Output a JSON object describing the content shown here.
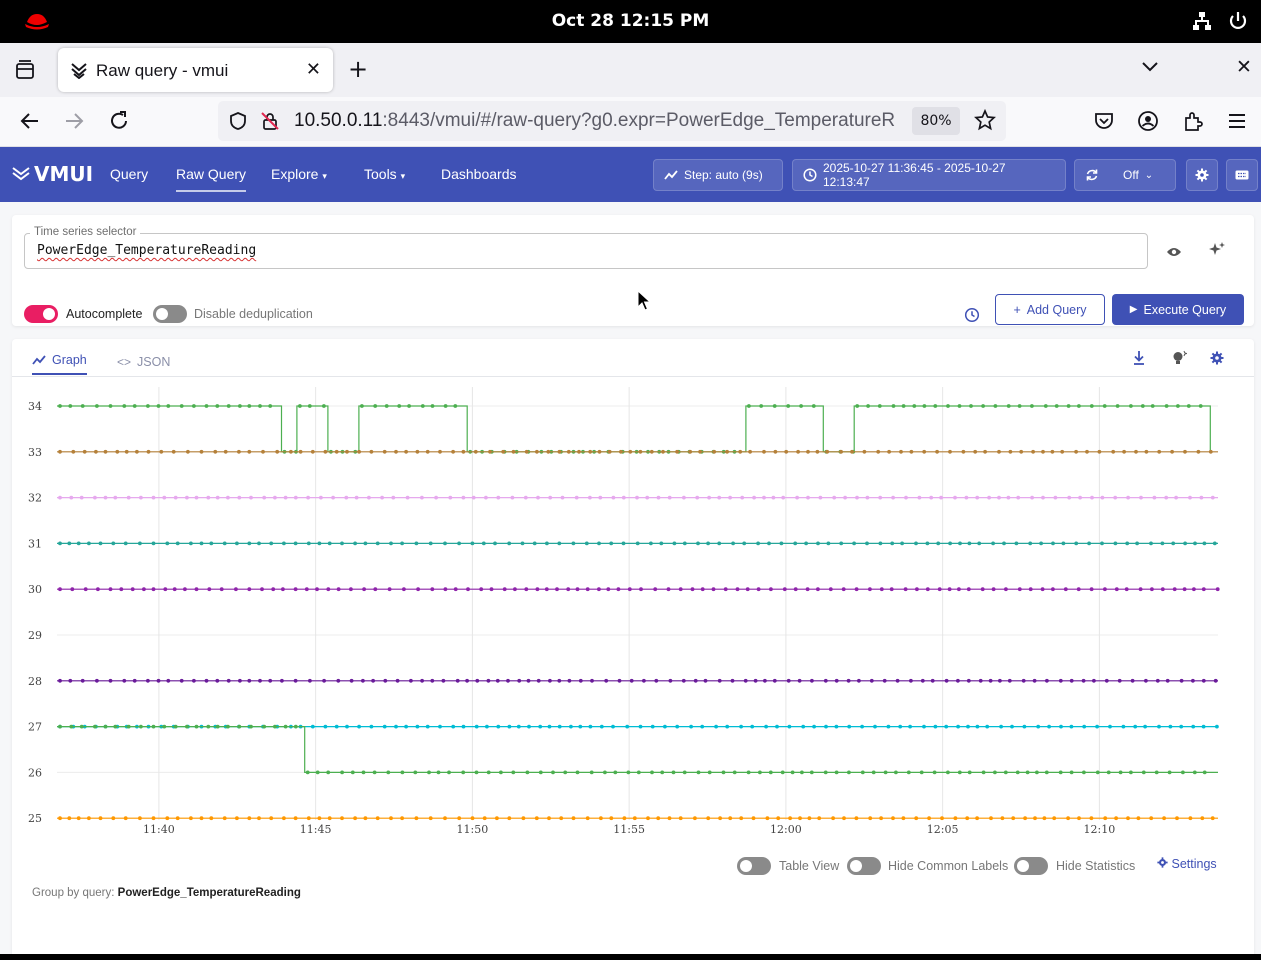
{
  "system": {
    "clock": "Oct 28  12:15 PM"
  },
  "browser": {
    "tab_title": "Raw query - vmui",
    "url_host": "10.50.0.11",
    "url_rest": ":8443/vmui/#/raw-query?g0.expr=PowerEdge_TemperatureR",
    "zoom": "80%"
  },
  "vmui": {
    "logo": "VMUI",
    "menu": [
      "Query",
      "Raw Query",
      "Explore",
      "Tools",
      "Dashboards"
    ],
    "step_label": "Step: auto (9s)",
    "time_range": "2025-10-27 11:36:45 - 2025-10-27 12:13:47",
    "refresh": "Off"
  },
  "query": {
    "field_label": "Time series selector",
    "expr": "PowerEdge_TemperatureReading",
    "autocomplete_label": "Autocomplete",
    "autocomplete_on": true,
    "dedup_label": "Disable deduplication",
    "dedup_on": false,
    "add_query": "Add Query",
    "execute_query": "Execute Query"
  },
  "graph": {
    "tabs": [
      "Graph",
      "JSON"
    ],
    "active_tab": "Graph",
    "footer": {
      "table_view": "Table View",
      "hide_common_labels": "Hide Common Labels",
      "hide_statistics": "Hide Statistics",
      "settings": "Settings"
    },
    "group_by_label": "Group by query:",
    "group_by_value": "PowerEdge_TemperatureReading"
  },
  "chart_data": {
    "type": "line",
    "y_ticks": [
      34,
      33,
      32,
      31,
      30,
      29,
      28,
      27,
      26,
      25
    ],
    "x_ticks": [
      "11:40",
      "11:45",
      "11:50",
      "11:55",
      "12:00",
      "12:05",
      "12:10"
    ],
    "x_date_label": "2025-10-27",
    "xlim": [
      "11:36:45",
      "12:13:47"
    ],
    "ylim": [
      24.7,
      34.3
    ],
    "grid": true,
    "series": [
      {
        "color": "#4caf50",
        "values": [
          [
            0,
            34
          ],
          [
            14.5,
            34
          ],
          [
            14.5,
            33
          ],
          [
            15.5,
            33
          ],
          [
            15.5,
            34
          ],
          [
            17.5,
            34
          ],
          [
            17.5,
            33
          ],
          [
            19.5,
            33
          ],
          [
            19.5,
            34
          ],
          [
            26.5,
            34
          ],
          [
            26.5,
            33
          ],
          [
            44.5,
            33
          ],
          [
            44.5,
            34
          ],
          [
            49.5,
            34
          ],
          [
            49.5,
            33
          ],
          [
            51.5,
            33
          ],
          [
            51.5,
            34
          ],
          [
            74.5,
            34
          ],
          [
            74.5,
            33
          ]
        ]
      },
      {
        "color": "#b5813a",
        "values": [
          [
            0,
            33
          ],
          [
            75,
            33
          ]
        ]
      },
      {
        "color": "#e6a9ee",
        "values": [
          [
            0,
            32
          ],
          [
            75,
            32
          ]
        ]
      },
      {
        "color": "#26a69a",
        "values": [
          [
            0,
            31
          ],
          [
            75,
            31
          ]
        ]
      },
      {
        "color": "#8e24aa",
        "values": [
          [
            0,
            30
          ],
          [
            75,
            30
          ]
        ]
      },
      {
        "color": "#6a1b9a",
        "values": [
          [
            0,
            28
          ],
          [
            75,
            28
          ]
        ]
      },
      {
        "color": "#00bcd4",
        "values": [
          [
            0,
            27
          ],
          [
            75,
            27
          ]
        ]
      },
      {
        "color": "#4caf50",
        "values": [
          [
            0,
            27
          ],
          [
            16,
            27
          ],
          [
            16,
            26
          ],
          [
            75,
            26
          ]
        ]
      },
      {
        "color": "#ff9800",
        "values": [
          [
            0,
            25
          ],
          [
            75,
            25
          ]
        ]
      }
    ]
  }
}
